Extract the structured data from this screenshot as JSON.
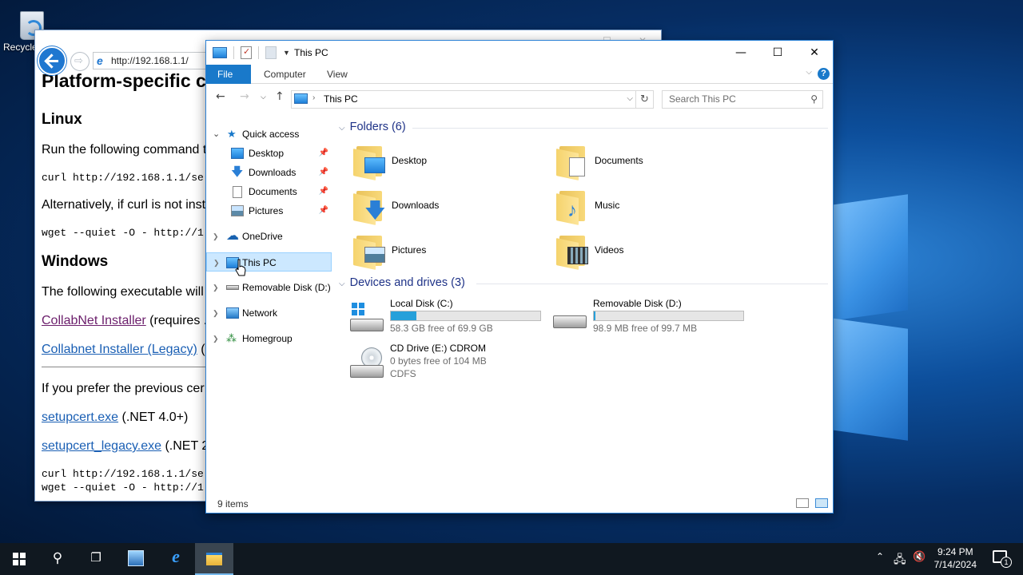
{
  "desktop": {
    "recycle_label": "Recycle Bin"
  },
  "browser": {
    "address": "http://192.168.1.1/",
    "h1": "Platform-specific c",
    "linux_heading": "Linux",
    "linux_text": "Run the following command t",
    "curl_cmd": "curl http://192.168.1.1/se",
    "alt_text": "Alternatively, if curl is not inst",
    "wget_cmd": "wget --quiet -O - http://1",
    "windows_heading": "Windows",
    "windows_text": "The following executable will",
    "link1": "CollabNet Installer",
    "link1_suffix": " (requires .",
    "link2": "Collabnet Installer (Legacy)",
    "link2_suffix": " (",
    "prev_text": "If you prefer the previous cer",
    "link3": "setupcert.exe",
    "link3_suffix": " (.NET 4.0+)",
    "link4": "setupcert_legacy.exe",
    "link4_suffix": " (.NET 2",
    "code_curl": "curl http://192.168.1.1/se",
    "code_wget": "wget --quiet -O - http://1"
  },
  "explorer": {
    "title": "This PC",
    "ribbon_tabs": [
      "File",
      "Computer",
      "View"
    ],
    "path": "This PC",
    "search_placeholder": "Search This PC",
    "sidebar": {
      "quick_access": "Quick access",
      "items": [
        "Desktop",
        "Downloads",
        "Documents",
        "Pictures"
      ],
      "onedrive": "OneDrive",
      "this_pc": "This PC",
      "removable": "Removable Disk (D:)",
      "network": "Network",
      "homegroup": "Homegroup"
    },
    "folders_header": "Folders (6)",
    "folders": [
      "Desktop",
      "Documents",
      "Downloads",
      "Music",
      "Pictures",
      "Videos"
    ],
    "drives_header": "Devices and drives (3)",
    "drives": [
      {
        "name": "Local Disk (C:)",
        "free": "58.3 GB free of 69.9 GB",
        "used_fraction": 0.17
      },
      {
        "name": "Removable Disk (D:)",
        "free": "98.9 MB free of 99.7 MB",
        "used_fraction": 0.01
      },
      {
        "name": "CD Drive (E:) CDROM",
        "free": "0 bytes free of 104 MB",
        "fs": "CDFS"
      }
    ],
    "status": "9 items"
  },
  "taskbar": {
    "time": "9:24 PM",
    "date": "7/14/2024",
    "notification_count": "1"
  },
  "colors": {
    "accent": "#1979ca",
    "drive_fill": "#26a0da",
    "selection": "#cce8ff"
  }
}
